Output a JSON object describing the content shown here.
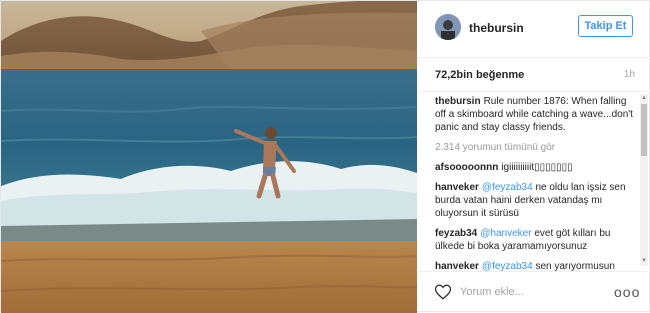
{
  "post": {
    "username": "thebursin",
    "follow_label": "Takip Et",
    "likes": "72,2bin beğenme",
    "time": "1h"
  },
  "comments": [
    {
      "user": "thebursin",
      "mention": "",
      "text": "Rule number 1876: When falling off a skimboard while catching a wave...don't panic and stay classy friends."
    },
    {
      "user": "",
      "mention": "",
      "text": "2.314 yorumun tümünü gör",
      "kind": "view_all"
    },
    {
      "user": "afsooooonnn",
      "mention": "",
      "text": "igiiiiiiiiiit▯▯▯▯▯▯▯"
    },
    {
      "user": "hanveker",
      "mention": "@feyzab34",
      "text": "ne oldu lan işsiz sen burda vatan haini derken vatandaş mı oluyorsun it sürüsü"
    },
    {
      "user": "feyzab34",
      "mention": "@hanveker",
      "text": "evet göt kılları bu ülkede bi boka yaramamıyorsunuz"
    },
    {
      "user": "hanveker",
      "mention": "@feyzab34",
      "text": "sen yarıyormusun"
    }
  ],
  "footer": {
    "add_comment_placeholder": "Yorum ekle...",
    "more_label": "ooo",
    "heart_icon": "heart-icon"
  },
  "colors": {
    "accent": "#3897f0",
    "text": "#262626",
    "muted": "#a5a5a5"
  }
}
